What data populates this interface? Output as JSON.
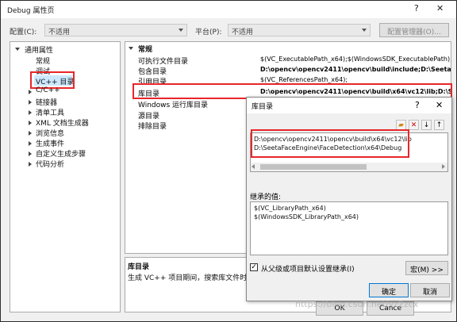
{
  "window": {
    "title": "Debug 属性页",
    "help": "?",
    "close": "✕"
  },
  "config": {
    "label": "配置(C):",
    "value": "不适用",
    "platform_label": "平台(P):",
    "platform_value": "不适用",
    "manager_button": "配置管理器(O)..."
  },
  "tree": {
    "root": "通用属性",
    "items": [
      "常规",
      "调试",
      "VC++ 目录",
      "C/C++",
      "链接器",
      "清单工具",
      "XML 文档生成器",
      "浏览信息",
      "生成事件",
      "自定义生成步骤",
      "代码分析"
    ]
  },
  "grid": {
    "section": "常规",
    "rows": [
      {
        "name": "可执行文件目录",
        "value": "$(VC_ExecutablePath_x64);$(WindowsSDK_ExecutablePath);$(V"
      },
      {
        "name": "包含目录",
        "value": "D:\\opencv\\opencv2411\\opencv\\build\\include;D:\\SeetaFac"
      },
      {
        "name": "引用目录",
        "value": "$(VC_ReferencesPath_x64);"
      },
      {
        "name": "库目录",
        "value": "D:\\opencv\\opencv2411\\opencv\\build\\x64\\vc12\\lib;D:\\Seet"
      },
      {
        "name": "Windows 运行库目录",
        "value": ""
      },
      {
        "name": "源目录",
        "value": ""
      },
      {
        "name": "排除目录",
        "value": ""
      }
    ]
  },
  "description": {
    "title": "库目录",
    "text": "生成 VC++ 项目期间，搜索库文件时"
  },
  "bottom_buttons": {
    "ok": "OK",
    "cancel": "Cance"
  },
  "subdialog": {
    "title": "库目录",
    "help": "?",
    "close": "✕",
    "entries": [
      "D:\\opencv\\opencv2411\\opencv\\build\\x64\\vc12\\lib",
      "D:\\SeetaFaceEngine\\FaceDetection\\x64\\Debug"
    ],
    "inherited_label": "继承的值:",
    "inherited": [
      "$(VC_LibraryPath_x64)",
      "$(WindowsSDK_LibraryPath_x64)"
    ],
    "inherit_checkbox": "从父级或项目默认设置继承(I)",
    "macro_button": "宏(M) >>",
    "ok": "确定",
    "cancel": "取消"
  },
  "watermark": "https://blog.csdn.net/yz2zcx",
  "colors": {
    "highlight": "#e8262a",
    "selection": "#cce8ff"
  }
}
